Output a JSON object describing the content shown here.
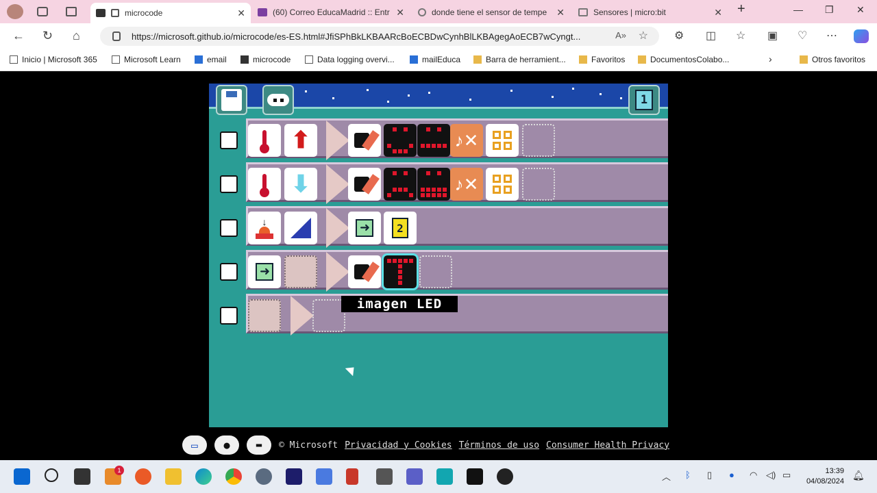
{
  "browser": {
    "tabs": [
      {
        "title": "microcode",
        "active": true
      },
      {
        "title": "(60) Correo EducaMadrid :: Entr"
      },
      {
        "title": "donde tiene el sensor de tempe"
      },
      {
        "title": "Sensores | micro:bit"
      }
    ],
    "url": "https://microsoft.github.io/microcode/es-ES.html#JfiSPhBkLKBAARcBoECBDwCynhBlLKBAgegAoECB7wCyngt...",
    "bookmarks": [
      "Inicio | Microsoft 365",
      "Microsoft Learn",
      "email",
      "microcode",
      "Data logging overvi...",
      "mailEduca",
      "Barra de herramient...",
      "Favoritos",
      "DocumentosColabo...",
      "Otros favoritos"
    ]
  },
  "microcode": {
    "page_number": "1",
    "tooltip": "imagen LED",
    "rules": [
      {
        "when": [
          "thermometer-icon",
          "arrow-up-icon"
        ],
        "do": [
          "paint-icon",
          "led-face-1",
          "led-face-2",
          "fx-orange",
          "sparkle-grid",
          "empty"
        ]
      },
      {
        "when": [
          "thermometer-icon",
          "arrow-down-icon"
        ],
        "do": [
          "paint-icon",
          "led-face-3",
          "led-face-4",
          "fx-orange",
          "sparkle-grid",
          "empty"
        ]
      },
      {
        "when": [
          "press-button-icon",
          "button-a-icon"
        ],
        "do": [
          "switch-page-icon",
          "page-2-icon"
        ]
      },
      {
        "when": [
          "page-start-icon",
          "empty"
        ],
        "do": [
          "paint-icon",
          "led-t",
          "empty"
        ]
      },
      {
        "when": [
          "empty",
          "empty"
        ],
        "do": []
      }
    ]
  },
  "footer": {
    "copyright": "© Microsoft",
    "privacy": "Privacidad y Cookies",
    "terms": "Términos de uso",
    "consumer": "Consumer Health Privacy"
  },
  "taskbar": {
    "time": "13:39",
    "date": "04/08/2024",
    "badge_count": "1"
  }
}
